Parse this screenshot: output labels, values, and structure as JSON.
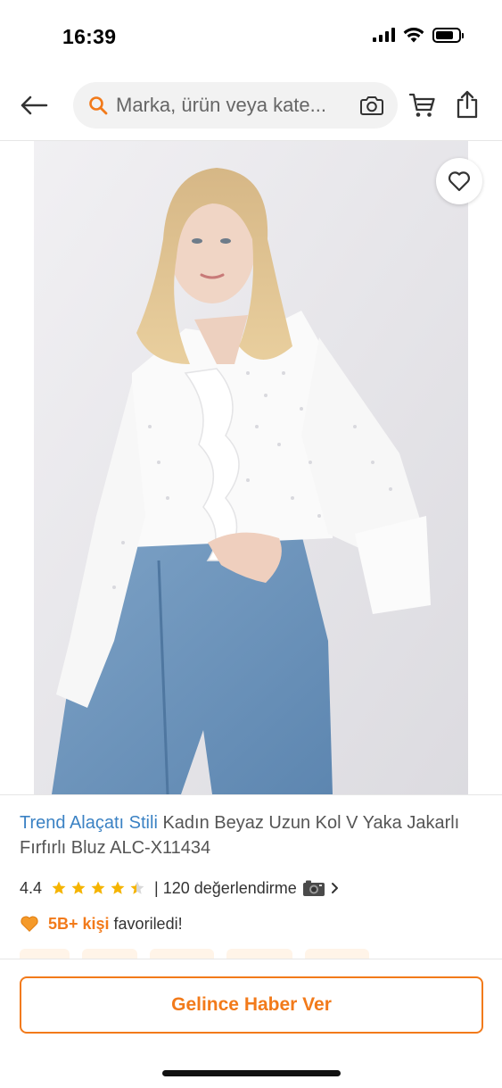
{
  "status_bar": {
    "time": "16:39",
    "icons": [
      "cellular-signal-icon",
      "wifi-icon",
      "battery-icon"
    ]
  },
  "header": {
    "back_icon": "back-arrow-icon",
    "search": {
      "placeholder": "Marka, ürün veya kate...",
      "value": "",
      "search_icon": "search-icon",
      "camera_icon": "camera-icon"
    },
    "cart_icon": "cart-icon",
    "share_icon": "share-icon"
  },
  "product": {
    "image": {
      "description_icon": "product-photo",
      "favorite_icon": "heart-icon",
      "carousel": {
        "count": 5,
        "active_index": 0
      }
    },
    "brand": "Trend Alaçatı Stili",
    "name": "Kadın Beyaz Uzun Kol V Yaka Jakarlı Fırfırlı Bluz ALC-X11434",
    "rating": {
      "value": "4.4",
      "stars": 4.4,
      "review_text": "| 120 değerlendirme",
      "camera_icon": "camera-emoji-icon",
      "chevron_icon": "chevron-right-icon"
    },
    "favorites": {
      "heart_icon": "orange-heart-icon",
      "count_text": "5B+ kişi",
      "suffix_text": "favoriledi!"
    }
  },
  "actions": {
    "notify_label": "Gelince Haber Ver"
  },
  "colors": {
    "accent": "#f27a1a",
    "brand_link": "#3b82c4",
    "star": "#f5b400",
    "search_bg": "#f2f2f2"
  }
}
